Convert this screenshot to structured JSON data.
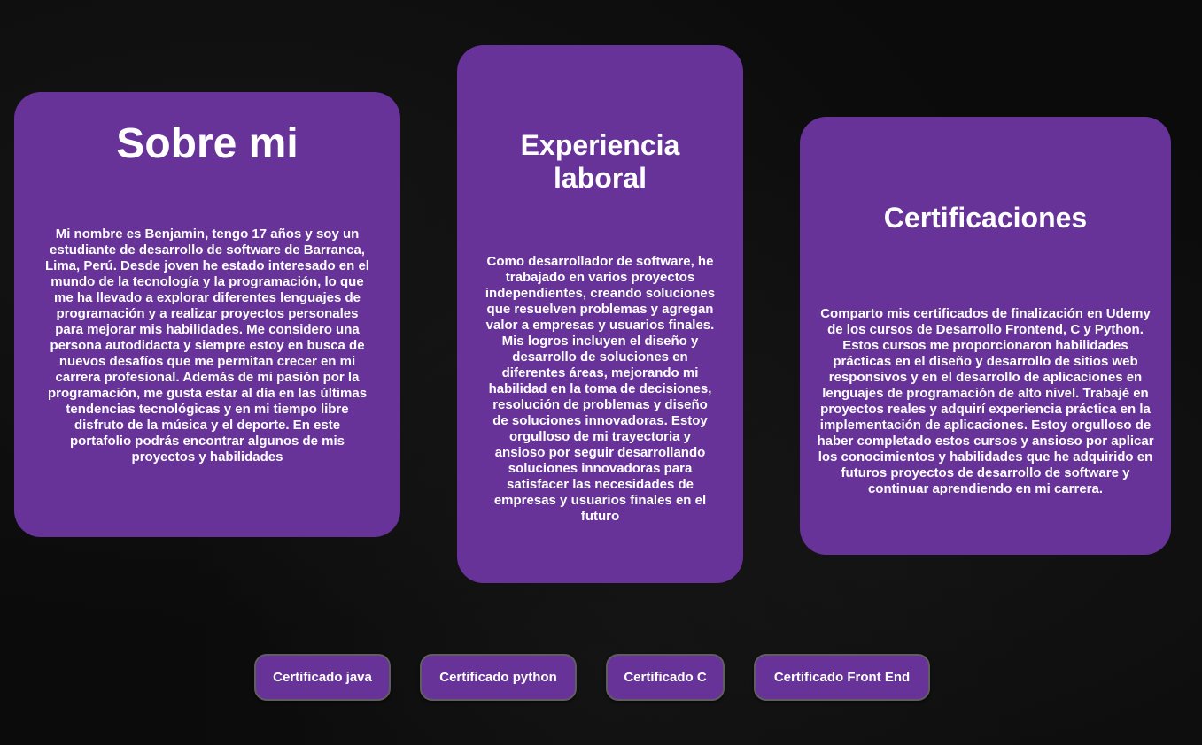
{
  "about": {
    "title": "Sobre mi",
    "text": "Mi nombre es Benjamin, tengo 17 años y soy un estudiante de desarrollo de software de Barranca, Lima, Perú. Desde joven he estado interesado en el mundo de la tecnología y la programación, lo que me ha llevado a explorar diferentes lenguajes de programación y a realizar proyectos personales para mejorar mis habilidades. Me considero una persona autodidacta y siempre estoy en busca de nuevos desafíos que me permitan crecer en mi carrera profesional. Además de mi pasión por la programación, me gusta estar al día en las últimas tendencias tecnológicas y en mi tiempo libre disfruto de la música y el deporte. En este portafolio podrás encontrar algunos de mis proyectos y habilidades"
  },
  "experience": {
    "title": "Experiencia laboral",
    "text": "Como desarrollador de software, he trabajado en varios proyectos independientes, creando soluciones que resuelven problemas y agregan valor a empresas y usuarios finales. Mis logros incluyen el diseño y desarrollo de soluciones en diferentes áreas, mejorando mi habilidad en la toma de decisiones, resolución de problemas y diseño de soluciones innovadoras. Estoy orgulloso de mi trayectoria y ansioso por seguir desarrollando soluciones innovadoras para satisfacer las necesidades de empresas y usuarios finales en el futuro"
  },
  "certifications": {
    "title": "Certificaciones",
    "text": "Comparto mis certificados de finalización en Udemy de los cursos de Desarrollo Frontend, C y Python. Estos cursos me proporcionaron habilidades prácticas en el diseño y desarrollo de sitios web responsivos y en el desarrollo de aplicaciones en lenguajes de programación de alto nivel. Trabajé en proyectos reales y adquirí experiencia práctica en la implementación de aplicaciones. Estoy orgulloso de haber completado estos cursos y ansioso por aplicar los conocimientos y habilidades que he adquirido en futuros proyectos de desarrollo de software y continuar aprendiendo en mi carrera."
  },
  "buttons": [
    {
      "label": "Certificado java"
    },
    {
      "label": "Certificado python"
    },
    {
      "label": "Certificado C"
    },
    {
      "label": "Certificado Front End"
    }
  ],
  "colors": {
    "background": "#0b0b0b",
    "card": "#673399",
    "text": "#ffffff",
    "button_border": "#5f5f5f"
  }
}
